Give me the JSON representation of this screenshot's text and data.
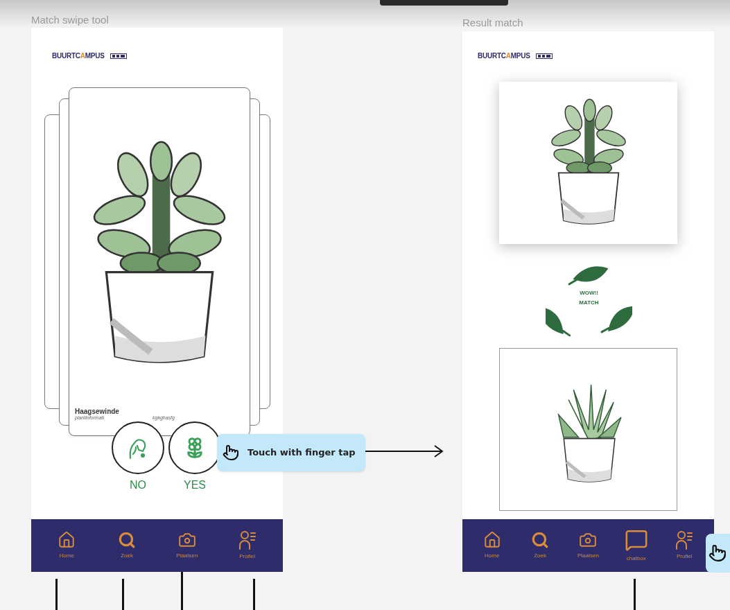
{
  "swipe_frame": {
    "title": "Match swipe tool",
    "logo": {
      "before": "BUURTC",
      "accent": "A",
      "after": "MPUS"
    },
    "card": {
      "name": "Haagsewinde",
      "info": [
        "plantinformati",
        "kgkghasfg"
      ]
    },
    "choices": [
      {
        "label": "NO",
        "kind": "reject"
      },
      {
        "label": "YES",
        "kind": "accept"
      }
    ],
    "hint": {
      "text": "Touch with finger tap"
    },
    "nav": [
      {
        "label": "Home",
        "kind": "home"
      },
      {
        "label": "Zoek",
        "kind": "search"
      },
      {
        "label": "Plaatsen",
        "kind": "camera"
      },
      {
        "label": "Profiel",
        "kind": "profile"
      }
    ]
  },
  "result_frame": {
    "title": "Result match",
    "logo": {
      "before": "BUURTC",
      "accent": "A",
      "after": "MPUS"
    },
    "badge": {
      "lines": [
        "WOW!!",
        "MATCH"
      ]
    },
    "nav": [
      {
        "label": "Home",
        "kind": "home"
      },
      {
        "label": "Zoek",
        "kind": "search"
      },
      {
        "label": "Plaatsen",
        "kind": "camera"
      },
      {
        "label": "chatbox",
        "kind": "chat"
      },
      {
        "label": "Profiel",
        "kind": "profile"
      }
    ]
  }
}
